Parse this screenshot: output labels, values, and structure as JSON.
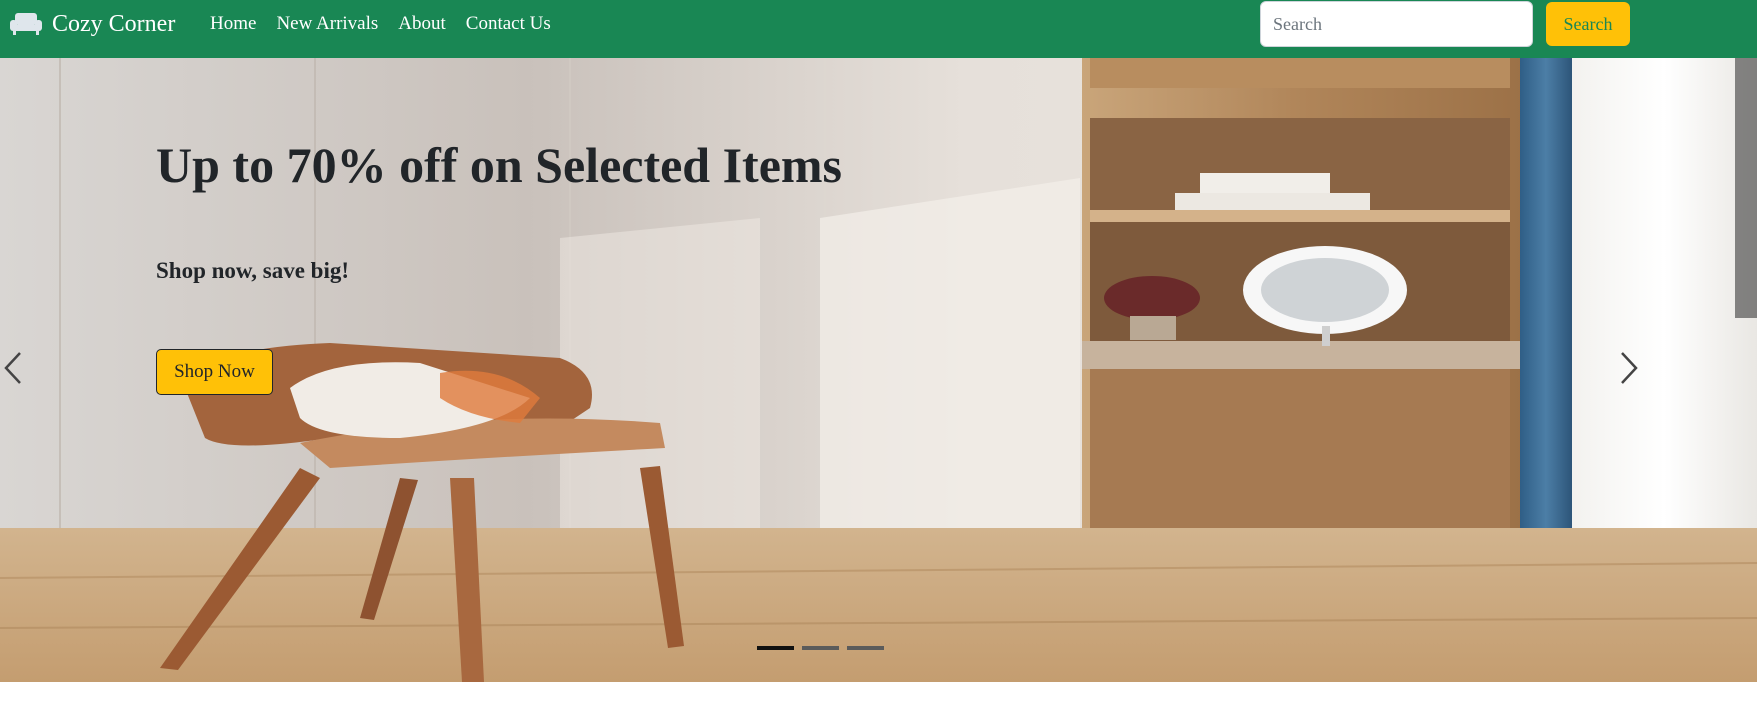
{
  "navbar": {
    "brand_icon": "sofa-icon",
    "brand_label": "Cozy Corner",
    "links": [
      "Home",
      "New Arrivals",
      "About",
      "Contact Us"
    ],
    "search_placeholder": "Search",
    "search_value": "",
    "search_button_label": "Search",
    "background_color": "#198754",
    "accent_color": "#ffc107"
  },
  "hero": {
    "title": "Up to 70% off on Selected Items",
    "subtitle": "Shop now, save big!",
    "cta_label": "Shop Now",
    "prev_icon": "chevron-left-icon",
    "next_icon": "chevron-right-icon",
    "slides_count": 3,
    "active_slide": 1
  }
}
